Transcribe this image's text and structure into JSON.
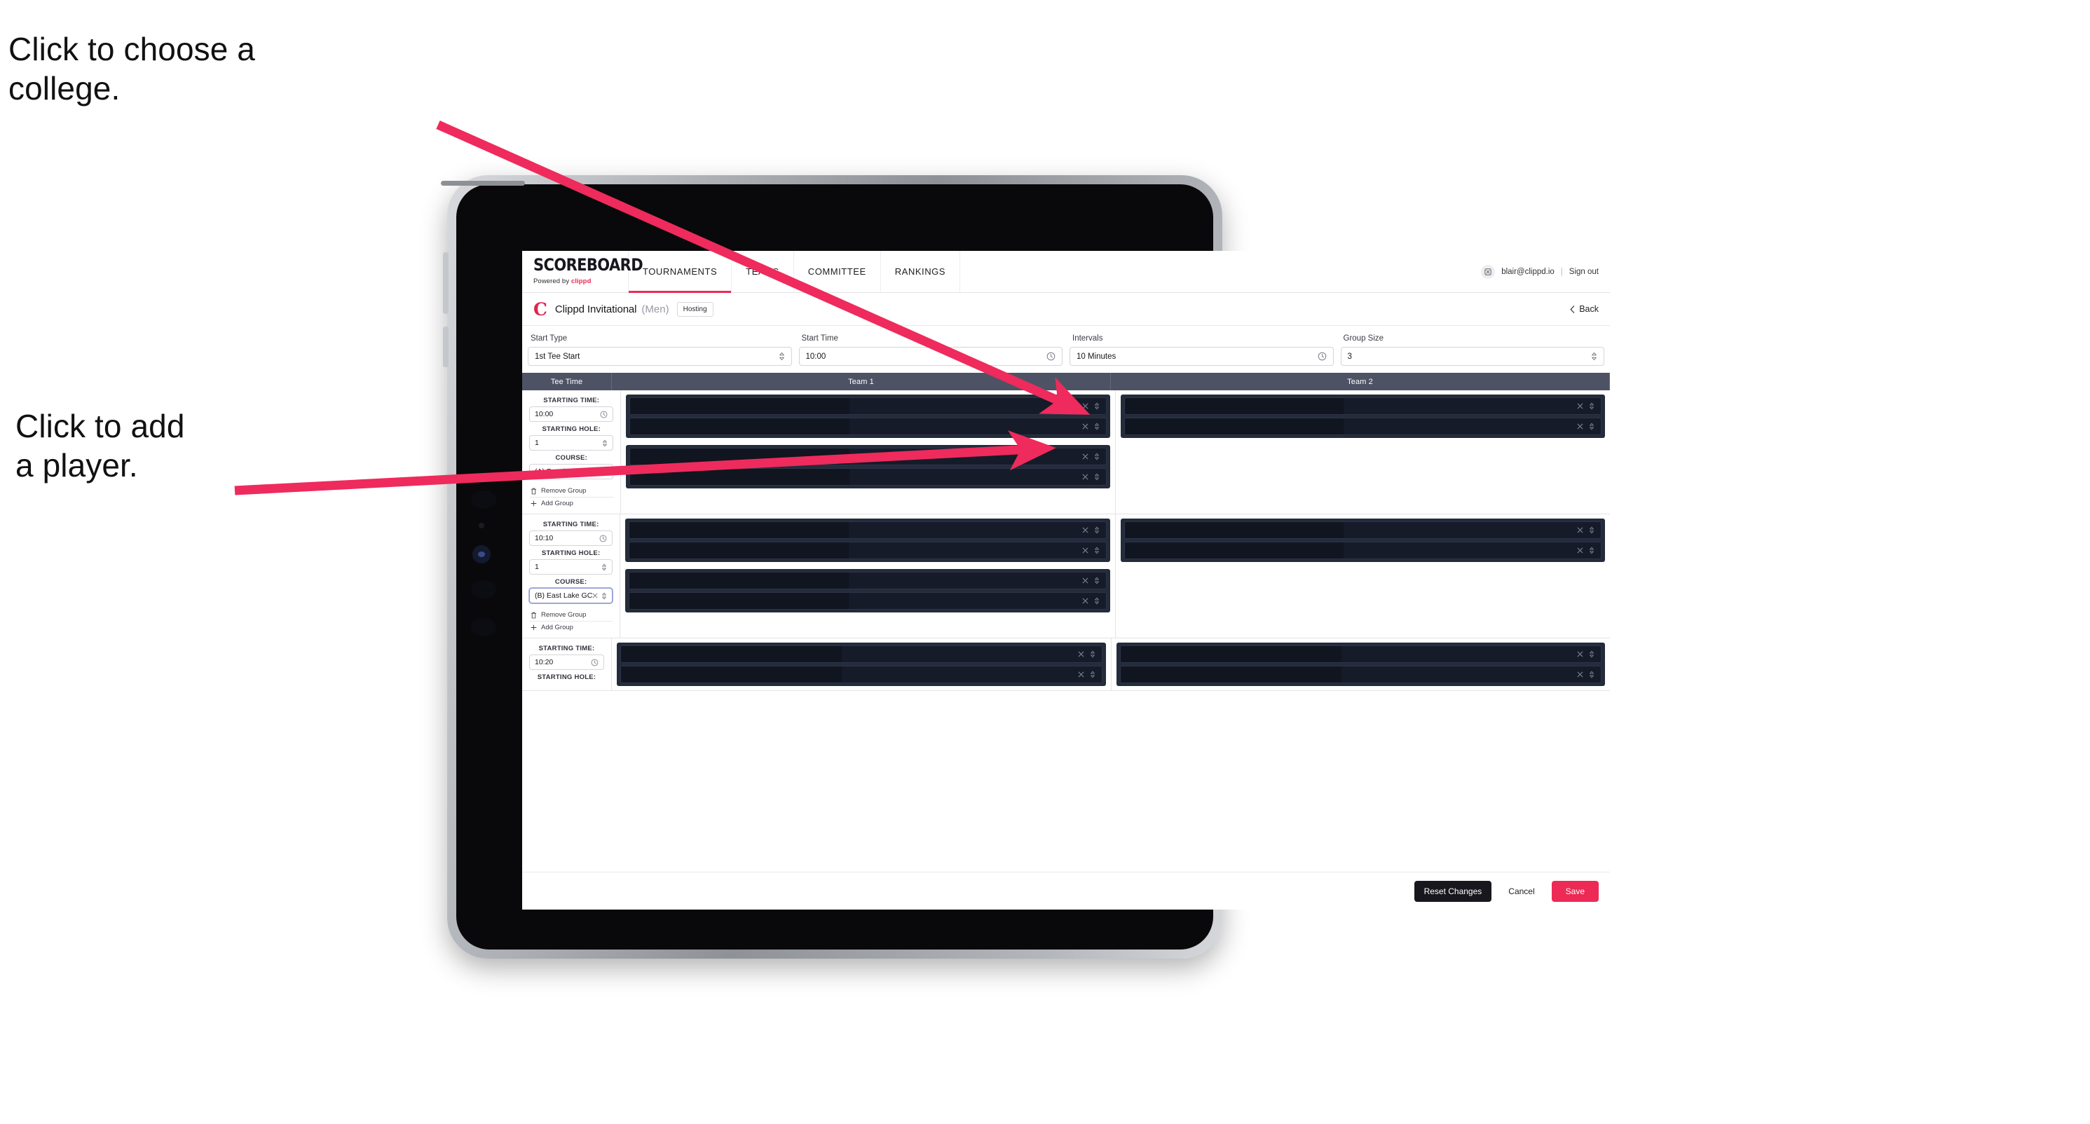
{
  "annotations": {
    "college": "Click to choose a\ncollege.",
    "player": "Click to add\na player."
  },
  "colors": {
    "accent_pink": "#ec2a55",
    "table_header": "#4d5365",
    "slot_dark": "#151b29",
    "group_dark": "#242b3b",
    "dark_button": "#17171d"
  },
  "nav": {
    "brand_name": "SCOREBOARD",
    "brand_sub_prefix": "Powered by ",
    "brand_sub_accent": "clippd",
    "tabs": [
      {
        "label": "TOURNAMENTS",
        "active": true
      },
      {
        "label": "TEAMS",
        "active": false
      },
      {
        "label": "COMMITTEE",
        "active": false
      },
      {
        "label": "RANKINGS",
        "active": false
      }
    ],
    "user_email": "blair@clippd.io",
    "separator": "|",
    "sign_out": "Sign out"
  },
  "tournament_bar": {
    "logo_letter": "C",
    "name": "Clippd Invitational",
    "gender": "(Men)",
    "status_badge": "Hosting",
    "back_label": "Back"
  },
  "filters": [
    {
      "label": "Start Type",
      "value": "1st Tee Start",
      "icon": "chevron-updown-icon"
    },
    {
      "label": "Start Time",
      "value": "10:00",
      "icon": "clock-icon"
    },
    {
      "label": "Intervals",
      "value": "10 Minutes",
      "icon": "clock-icon"
    },
    {
      "label": "Group Size",
      "value": "3",
      "icon": "chevron-updown-icon"
    }
  ],
  "table": {
    "columns": [
      "Tee Time",
      "Team 1",
      "Team 2"
    ],
    "field_labels": {
      "starting_time": "STARTING TIME:",
      "starting_hole": "STARTING HOLE:",
      "course": "COURSE:"
    },
    "group_actions": {
      "remove": "Remove Group",
      "add": "Add Group"
    },
    "rows": [
      {
        "starting_time": "10:00",
        "starting_hole": "1",
        "course": "(A) Peachtree GC",
        "course_focused": false,
        "team1_groups": [
          2,
          2
        ],
        "team2_groups": [
          2
        ]
      },
      {
        "starting_time": "10:10",
        "starting_hole": "1",
        "course": "(B) East Lake GC",
        "course_focused": true,
        "team1_groups": [
          2,
          2
        ],
        "team2_groups": [
          2
        ]
      },
      {
        "starting_time": "10:20",
        "starting_hole": "",
        "course": "",
        "course_focused": false,
        "team1_groups": [
          2
        ],
        "team2_groups": [
          2
        ]
      }
    ]
  },
  "footer": {
    "reset": "Reset Changes",
    "cancel": "Cancel",
    "save": "Save"
  }
}
